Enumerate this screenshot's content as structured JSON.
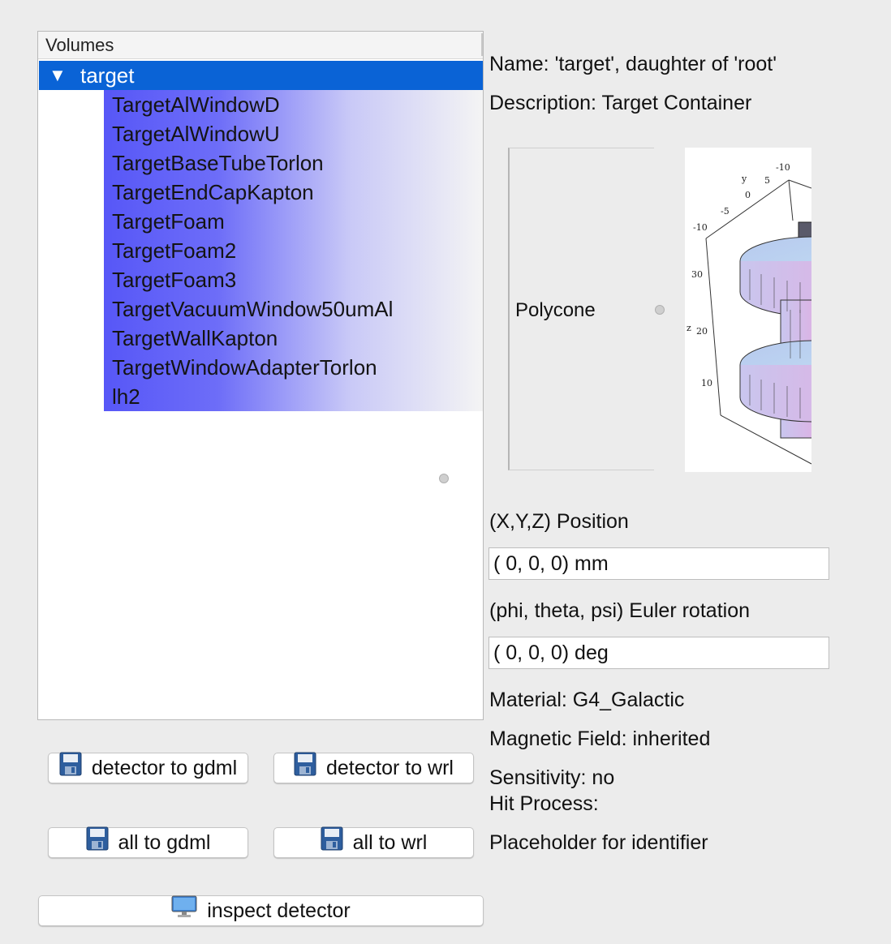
{
  "tree": {
    "header": "Volumes",
    "root": {
      "label": "target",
      "expanded": true
    },
    "children": [
      "TargetAlWindowD",
      "TargetAlWindowU",
      "TargetBaseTubeTorlon",
      "TargetEndCapKapton",
      "TargetFoam",
      "TargetFoam2",
      "TargetFoam3",
      "TargetVacuumWindow50umAl",
      "TargetWallKapton",
      "TargetWindowAdapterTorlon",
      "lh2"
    ]
  },
  "buttons": {
    "detector_to_gdml": "detector to gdml",
    "detector_to_wrl": "detector to wrl",
    "all_to_gdml": "all to gdml",
    "all_to_wrl": "all to wrl",
    "inspect_detector": "inspect detector"
  },
  "details": {
    "name": "Name: 'target', daughter of 'root'",
    "description": "Description: Target Container",
    "shape": "Polycone",
    "position_label": "(X,Y,Z) Position",
    "position_value": "( 0, 0, 0) mm",
    "rotation_label": "(phi, theta, psi) Euler rotation",
    "rotation_value": "( 0, 0, 0) deg",
    "material": "Material: G4_Galactic",
    "magnetic_field": "Magnetic Field: inherited",
    "sensitivity": "Sensitivity: no",
    "hit_process": "Hit Process:",
    "identifier": "Placeholder for identifier"
  },
  "plot_labels": {
    "y_axis": "y",
    "z_axis": "z",
    "x_tick_top": "-10",
    "y_ticks": [
      "5",
      "0",
      "-5"
    ],
    "x_tick_left": "-10",
    "z_ticks": [
      "30",
      "20",
      "10"
    ]
  },
  "colors": {
    "selection": "#0a63d6",
    "child_gradient_start": "#5757f7",
    "background": "#ececec"
  }
}
